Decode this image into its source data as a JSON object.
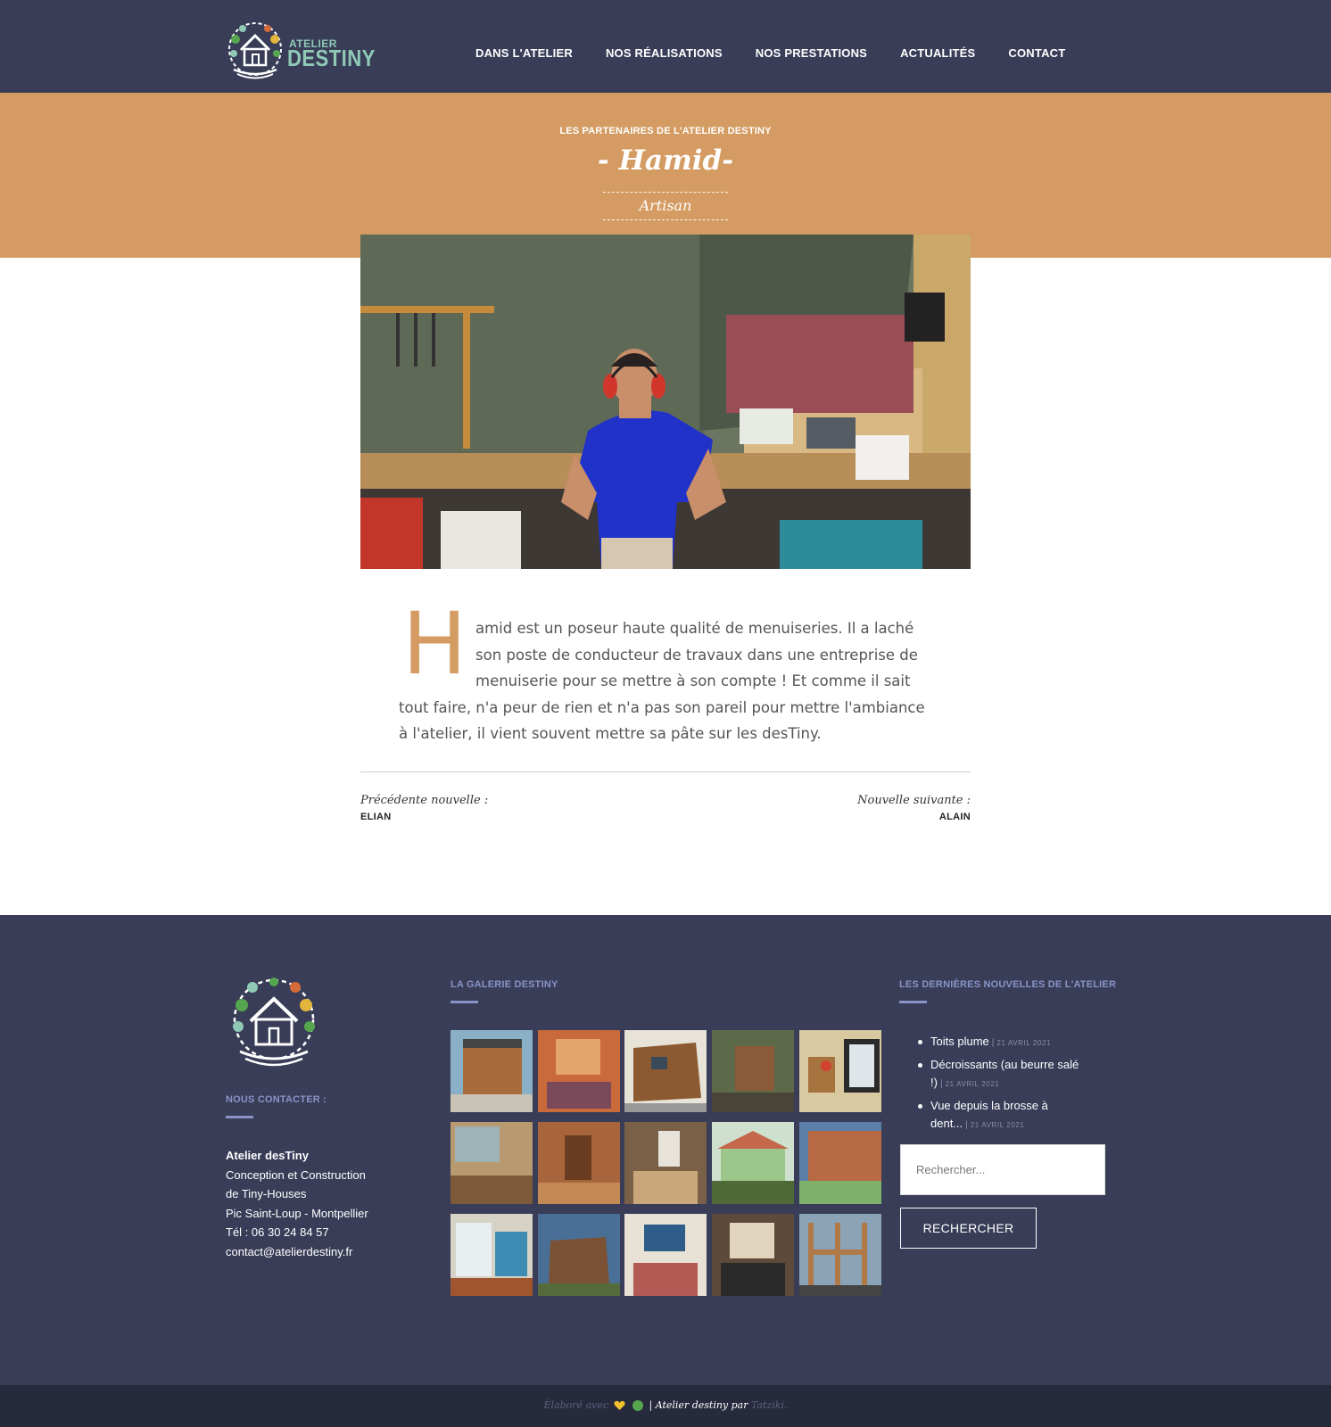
{
  "header": {
    "logo_small": "ATELIER",
    "logo_big": "DESTINY",
    "nav": [
      {
        "label": "DANS L'ATELIER"
      },
      {
        "label": "NOS RÉALISATIONS"
      },
      {
        "label": "NOS PRESTATIONS"
      },
      {
        "label": "ACTUALITÉS"
      },
      {
        "label": "CONTACT"
      }
    ]
  },
  "hero": {
    "kicker": "LES PARTENAIRES DE L'ATELIER DESTINY",
    "title": "- Hamid-",
    "subtitle": "Artisan",
    "accent_color": "#d49b62"
  },
  "article": {
    "dropcap": "H",
    "body": "amid est un poseur haute qualité de menuiseries. Il a laché son poste de conducteur de travaux dans une entreprise de menuiserie pour se mettre à son compte ! Et comme il sait tout faire, n'a peur de rien et n'a pas son pareil pour mettre l'ambiance à l'atelier, il vient souvent mettre sa pâte sur les desTiny."
  },
  "post_nav": {
    "prev_label": "Précédente nouvelle :",
    "prev_title": "ELIAN",
    "next_label": "Nouvelle suivante :",
    "next_title": "ALAIN"
  },
  "footer": {
    "contact_heading": "NOUS CONTACTER :",
    "contact_name": "Atelier desTiny",
    "contact_line1": "Conception et Construction",
    "contact_line2": "de Tiny-Houses",
    "contact_line3": "Pic Saint-Loup - Montpellier",
    "contact_phone": "Tél : 06 30 24 84 57",
    "contact_email": "contact@atelierdestiny.fr",
    "gallery_heading": "LA GALERIE DESTINY",
    "news_heading": "LES DERNIÈRES NOUVELLES DE L'ATELIER",
    "news": [
      {
        "title": "Toits plume",
        "date": "21 AVRIL 2021"
      },
      {
        "title": "Décroissants (au beurre salé !)",
        "date": "21 AVRIL 2021"
      },
      {
        "title": "Vue depuis la brosse à dent...",
        "date": "21 AVRIL 2021"
      }
    ],
    "search_placeholder": "Rechercher...",
    "search_button": "RECHERCHER"
  },
  "bottom": {
    "credit_prefix": "Élaboré avec",
    "credit_middle": "| Atelier destiny par",
    "credit_author": "Tatziki",
    "credit_suffix": "."
  },
  "colors": {
    "header_bg": "#393d57",
    "band": "#d49b62",
    "footer_accent": "#8a93c8",
    "bottom_bg": "#272a3d"
  }
}
